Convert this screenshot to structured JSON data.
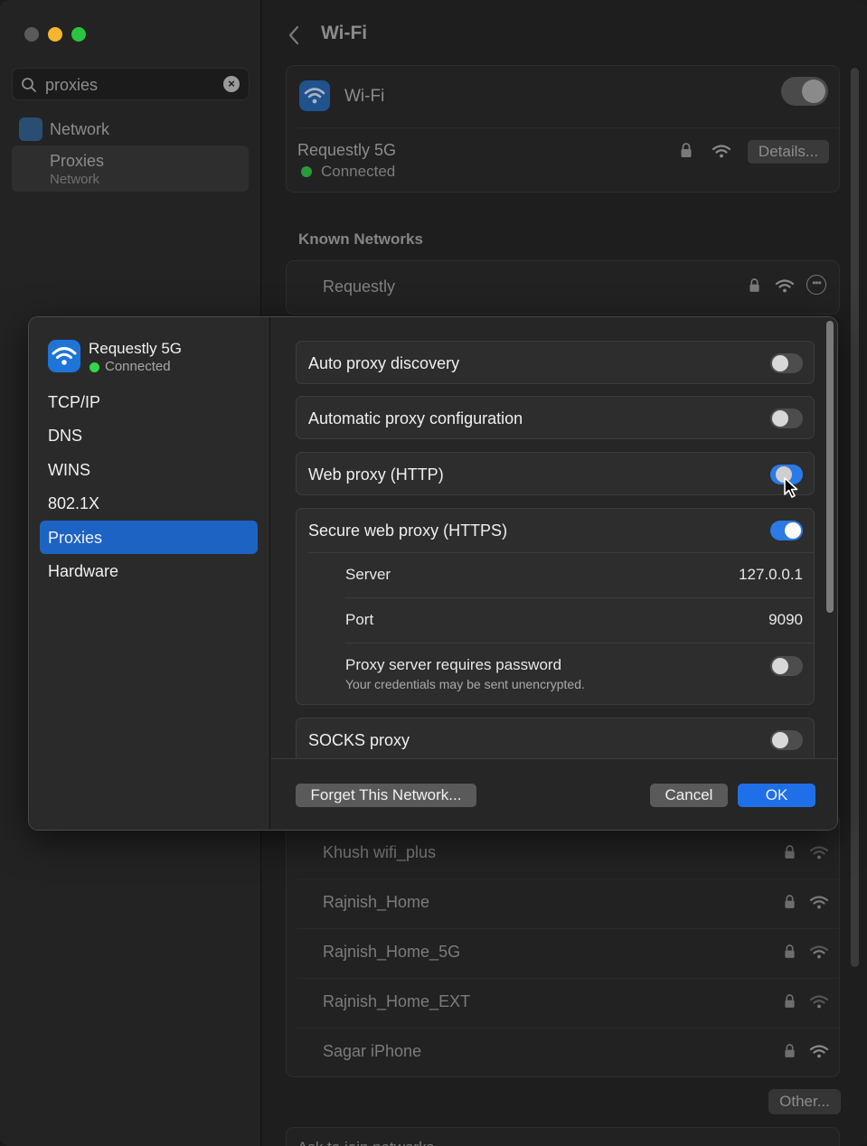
{
  "window": {
    "search": {
      "value": "proxies"
    },
    "sidebar": {
      "network_label": "Network",
      "proxies_label": "Proxies",
      "proxies_sub": "Network"
    },
    "title": "Wi-Fi",
    "wifi_card": {
      "label": "Wi-Fi",
      "network_name": "Requestly 5G",
      "status": "Connected",
      "details_label": "Details..."
    },
    "known_networks_title": "Known Networks",
    "known_networks": [
      {
        "name": "Requestly"
      },
      {
        "name": "Khush wifi_plus"
      },
      {
        "name": "Rajnish_Home"
      },
      {
        "name": "Rajnish_Home_5G"
      },
      {
        "name": "Rajnish_Home_EXT"
      },
      {
        "name": "Sagar iPhone"
      }
    ],
    "other_label": "Other...",
    "ask_join_label": "Ask to join networks"
  },
  "sheet": {
    "network_name": "Requestly 5G",
    "network_status": "Connected",
    "tabs": [
      {
        "label": "TCP/IP"
      },
      {
        "label": "DNS"
      },
      {
        "label": "WINS"
      },
      {
        "label": "802.1X"
      },
      {
        "label": "Proxies"
      },
      {
        "label": "Hardware"
      }
    ],
    "rows": {
      "auto_discovery": "Auto proxy discovery",
      "auto_config": "Automatic proxy configuration",
      "web_proxy": "Web proxy (HTTP)",
      "secure_proxy": "Secure web proxy (HTTPS)",
      "server_label": "Server",
      "server_value": "127.0.0.1",
      "port_label": "Port",
      "port_value": "9090",
      "password_label": "Proxy server requires password",
      "password_hint": "Your credentials may be sent unencrypted.",
      "socks": "SOCKS proxy"
    },
    "buttons": {
      "forget": "Forget This Network...",
      "cancel": "Cancel",
      "ok": "OK"
    }
  },
  "colors": {
    "accent": "#1f70e8",
    "selected_tab": "#1d63c4",
    "connected_green": "#32d74b"
  }
}
